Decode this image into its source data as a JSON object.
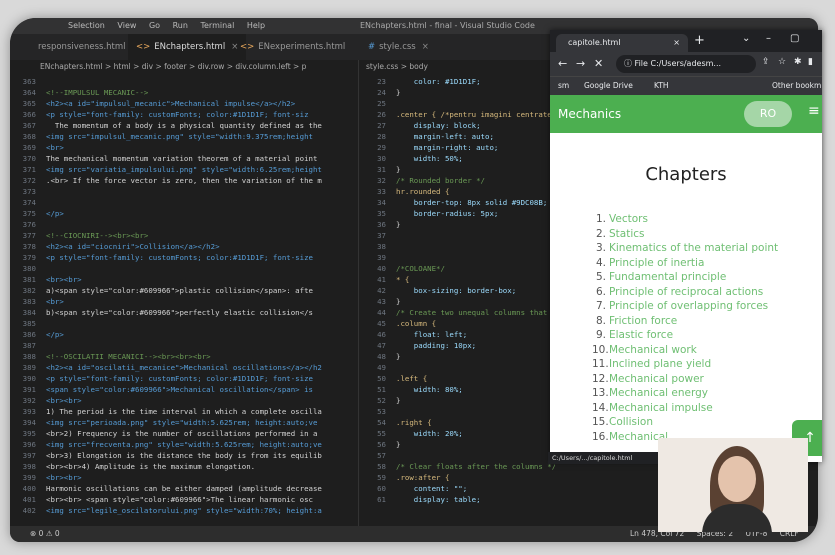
{
  "editor": {
    "menu": [
      "Selection",
      "View",
      "Go",
      "Run",
      "Terminal",
      "Help"
    ],
    "window_title": "ENchapters.html - final - Visual Studio Code",
    "tabs": [
      {
        "label": "responsiveness.html"
      },
      {
        "label": "ENchapters.html"
      },
      {
        "label": "ENexperiments.html"
      },
      {
        "label": "style.css"
      }
    ],
    "breadcrumb_left": "ENchapters.html > html > div > footer > div.row > div.column.left > p",
    "breadcrumb_right": "style.css > body",
    "left_lines": [
      {
        "n": "363",
        "cls": "c-txt",
        "t": ""
      },
      {
        "n": "364",
        "cls": "c-com",
        "t": "<!--IMPULSUL MECANIC-->"
      },
      {
        "n": "365",
        "cls": "c-tag",
        "t": "<h2><a id=\"impulsul_mecanic\">Mechanical impulse</a></h2>"
      },
      {
        "n": "366",
        "cls": "c-tag",
        "t": "<p style=\"font-family: customFonts; color:#1D1D1F; font-siz"
      },
      {
        "n": "367",
        "cls": "c-txt",
        "t": "  The momentum of a body is a physical quantity defined as the"
      },
      {
        "n": "368",
        "cls": "c-tag",
        "t": "<img src=\"impulsul_mecanic.png\" style=\"width:9.375rem;height"
      },
      {
        "n": "369",
        "cls": "c-tag",
        "t": "<br>"
      },
      {
        "n": "370",
        "cls": "c-txt",
        "t": "The mechanical momentum variation theorem of a material point"
      },
      {
        "n": "371",
        "cls": "c-tag",
        "t": "<img src=\"variatia_impulsului.png\" style=\"width:6.25rem;height"
      },
      {
        "n": "372",
        "cls": "c-txt",
        "t": ".<br> If the force vector is zero, then the variation of the m"
      },
      {
        "n": "373",
        "cls": "c-txt",
        "t": ""
      },
      {
        "n": "374",
        "cls": "c-txt",
        "t": ""
      },
      {
        "n": "375",
        "cls": "c-tag",
        "t": "</p>"
      },
      {
        "n": "376",
        "cls": "c-txt",
        "t": ""
      },
      {
        "n": "377",
        "cls": "c-com",
        "t": "<!--CIOCNIRI--><br><br>"
      },
      {
        "n": "378",
        "cls": "c-tag",
        "t": "<h2><a id=\"ciocniri\">Collision</a></h2>"
      },
      {
        "n": "379",
        "cls": "c-tag",
        "t": "<p style=\"font-family: customFonts; color:#1D1D1F; font-size"
      },
      {
        "n": "380",
        "cls": "c-txt",
        "t": ""
      },
      {
        "n": "381",
        "cls": "c-tag",
        "t": "<br><br>"
      },
      {
        "n": "382",
        "cls": "c-txt",
        "t": "a)<span style=\"color:#609966\">plastic collision</span>: afte"
      },
      {
        "n": "383",
        "cls": "c-tag",
        "t": "<br>"
      },
      {
        "n": "384",
        "cls": "c-txt",
        "t": "b)<span style=\"color:#609966\">perfectly elastic collision</s"
      },
      {
        "n": "385",
        "cls": "c-txt",
        "t": ""
      },
      {
        "n": "386",
        "cls": "c-tag",
        "t": "</p>"
      },
      {
        "n": "387",
        "cls": "c-txt",
        "t": ""
      },
      {
        "n": "388",
        "cls": "c-com",
        "t": "<!--OSCILATII MECANICI--><br><br><br>"
      },
      {
        "n": "389",
        "cls": "c-tag",
        "t": "<h2><a id=\"oscilatii_mecanice\">Mechanical oscillations</a></h2"
      },
      {
        "n": "390",
        "cls": "c-tag",
        "t": "<p style=\"font-family: customFonts; color:#1D1D1F; font-size"
      },
      {
        "n": "391",
        "cls": "c-tag",
        "t": "<span style=\"color:#609966\">Mechanical oscillation</span> is"
      },
      {
        "n": "392",
        "cls": "c-tag",
        "t": "<br><br>"
      },
      {
        "n": "393",
        "cls": "c-txt",
        "t": "1) The period is the time interval in which a complete oscilla"
      },
      {
        "n": "394",
        "cls": "c-tag",
        "t": "<img src=\"perioada.png\" style=\"width:5.625rem; height:auto;ve"
      },
      {
        "n": "395",
        "cls": "c-txt",
        "t": "<br>2) Frequency is the number of oscillations performed in a"
      },
      {
        "n": "396",
        "cls": "c-tag",
        "t": "<img src=\"frecventa.png\" style=\"width:5.625rem; height:auto;ve"
      },
      {
        "n": "397",
        "cls": "c-txt",
        "t": "<br>3) Elongation is the distance the body is from its equilib"
      },
      {
        "n": "398",
        "cls": "c-txt",
        "t": "<br><br>4) Amplitude is the maximum elongation."
      },
      {
        "n": "399",
        "cls": "c-tag",
        "t": "<br><br>"
      },
      {
        "n": "400",
        "cls": "c-txt",
        "t": "Harmonic oscillations can be either damped (amplitude decrease"
      },
      {
        "n": "401",
        "cls": "c-txt",
        "t": "<br><br> <span style=\"color:#609966\">The linear harmonic osc"
      },
      {
        "n": "402",
        "cls": "c-tag",
        "t": "<img src=\"legile_oscilatorului.png\" style=\"width:70%; height:a"
      }
    ],
    "right_lines": [
      {
        "n": "23",
        "cls": "c-prop",
        "t": "    color: #1D1D1F;"
      },
      {
        "n": "24",
        "cls": "c-txt",
        "t": "}"
      },
      {
        "n": "25",
        "cls": "c-txt",
        "t": ""
      },
      {
        "n": "26",
        "cls": "c-sel",
        "t": ".center { /*pentru imagini centrate"
      },
      {
        "n": "27",
        "cls": "c-prop",
        "t": "    display: block;"
      },
      {
        "n": "28",
        "cls": "c-prop",
        "t": "    margin-left: auto;"
      },
      {
        "n": "29",
        "cls": "c-prop",
        "t": "    margin-right: auto;"
      },
      {
        "n": "30",
        "cls": "c-prop",
        "t": "    width: 50%;"
      },
      {
        "n": "31",
        "cls": "c-txt",
        "t": "}"
      },
      {
        "n": "32",
        "cls": "c-com",
        "t": "/* Rounded border */"
      },
      {
        "n": "33",
        "cls": "c-sel",
        "t": "hr.rounded {"
      },
      {
        "n": "34",
        "cls": "c-prop",
        "t": "    border-top: 8px solid #9DC08B;"
      },
      {
        "n": "35",
        "cls": "c-prop",
        "t": "    border-radius: 5px;"
      },
      {
        "n": "36",
        "cls": "c-txt",
        "t": "}"
      },
      {
        "n": "37",
        "cls": "c-txt",
        "t": ""
      },
      {
        "n": "38",
        "cls": "c-txt",
        "t": ""
      },
      {
        "n": "39",
        "cls": "c-txt",
        "t": ""
      },
      {
        "n": "40",
        "cls": "c-com",
        "t": "/*COLOANE*/"
      },
      {
        "n": "41",
        "cls": "c-sel",
        "t": "* {"
      },
      {
        "n": "42",
        "cls": "c-prop",
        "t": "    box-sizing: border-box;"
      },
      {
        "n": "43",
        "cls": "c-txt",
        "t": "}"
      },
      {
        "n": "44",
        "cls": "c-com",
        "t": "/* Create two unequal columns that"
      },
      {
        "n": "45",
        "cls": "c-sel",
        "t": ".column {"
      },
      {
        "n": "46",
        "cls": "c-prop",
        "t": "    float: left;"
      },
      {
        "n": "47",
        "cls": "c-prop",
        "t": "    padding: 10px;"
      },
      {
        "n": "48",
        "cls": "c-txt",
        "t": "}"
      },
      {
        "n": "49",
        "cls": "c-txt",
        "t": ""
      },
      {
        "n": "50",
        "cls": "c-sel",
        "t": ".left {"
      },
      {
        "n": "51",
        "cls": "c-prop",
        "t": "    width: 80%;"
      },
      {
        "n": "52",
        "cls": "c-txt",
        "t": "}"
      },
      {
        "n": "53",
        "cls": "c-txt",
        "t": ""
      },
      {
        "n": "54",
        "cls": "c-sel",
        "t": ".right {"
      },
      {
        "n": "55",
        "cls": "c-prop",
        "t": "    width: 20%;"
      },
      {
        "n": "56",
        "cls": "c-txt",
        "t": "}"
      },
      {
        "n": "57",
        "cls": "c-txt",
        "t": ""
      },
      {
        "n": "58",
        "cls": "c-com",
        "t": "/* Clear floats after the columns */"
      },
      {
        "n": "59",
        "cls": "c-sel",
        "t": ".row:after {"
      },
      {
        "n": "60",
        "cls": "c-prop",
        "t": "    content: \"\";"
      },
      {
        "n": "61",
        "cls": "c-prop",
        "t": "    display: table;"
      }
    ],
    "status_left": "⊗ 0 ⚠ 0",
    "status_right": [
      "Ln 478, Col 72",
      "Spaces: 2",
      "UTF-8",
      "CRLF"
    ]
  },
  "browser": {
    "tab_title": "capitole.html",
    "url": "File  C:/Users/adesm...",
    "bookmarks": [
      "sm",
      "Google Drive",
      "KTH",
      "Other bookm"
    ],
    "hover_url": "C:/Users/.../capitole.html"
  },
  "page": {
    "app_title": "Mechanics",
    "app_button": "RO",
    "heading": "Chapters",
    "chapters": [
      "Vectors",
      "Statics",
      "Kinematics of the material point",
      "Principle of inertia",
      "Fundamental principle",
      "Principle of reciprocal actions",
      "Principle of overlapping forces",
      "Friction force",
      "Elastic force",
      "Mechanical work",
      "Inclined plane yield",
      "Mechanical power",
      "Mechanical energy",
      "Mechanical impulse",
      "Collision",
      "Mechanical"
    ]
  },
  "colors": {
    "accent": "#4caf50",
    "link": "#6fbf73",
    "code_bg": "#1e1e1e"
  }
}
